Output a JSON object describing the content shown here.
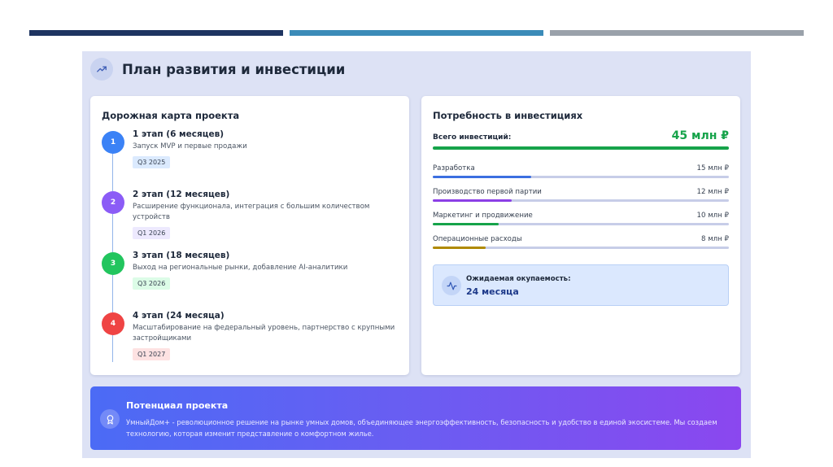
{
  "header": {
    "title": "План развития и инвестиции"
  },
  "roadmap": {
    "title": "Дорожная карта проекта",
    "stages": [
      {
        "num": "1",
        "name": "1 этап (6 месяцев)",
        "desc": "Запуск MVP и первые продажи",
        "badge": "Q3 2025",
        "color": "#3b82f6",
        "badge_bg": "#dbeafe"
      },
      {
        "num": "2",
        "name": "2 этап (12 месяцев)",
        "desc": "Расширение функционала, интеграция с большим количеством устройств",
        "badge": "Q1 2026",
        "color": "#8b5cf6",
        "badge_bg": "#ede9fe"
      },
      {
        "num": "3",
        "name": "3 этап (18 месяцев)",
        "desc": "Выход на региональные рынки, добавление AI-аналитики",
        "badge": "Q3 2026",
        "color": "#22c55e",
        "badge_bg": "#dcfce7"
      },
      {
        "num": "4",
        "name": "4 этап (24 месяца)",
        "desc": "Масштабирование на федеральный уровень, партнерство с крупными застройщиками",
        "badge": "Q1 2027",
        "color": "#ef4444",
        "badge_bg": "#fee2e2"
      }
    ]
  },
  "investment": {
    "title": "Потребность в инвестициях",
    "total_label": "Всего инвестиций:",
    "total_value": "45 млн ₽",
    "total_fill": 1.0,
    "items": [
      {
        "label": "Разработка",
        "value": "15 млн ₽",
        "fill": 0.333,
        "color": "#3b6fe0"
      },
      {
        "label": "Производство первой партии",
        "value": "12 млн ₽",
        "fill": 0.267,
        "color": "#8b3fe6"
      },
      {
        "label": "Маркетинг и продвижение",
        "value": "10 млн ₽",
        "fill": 0.222,
        "color": "#16a34a"
      },
      {
        "label": "Операционные расходы",
        "value": "8 млн ₽",
        "fill": 0.178,
        "color": "#b08a00"
      }
    ],
    "payback_label": "Ожидаемая окупаемость:",
    "payback_value": "24 месяца"
  },
  "potential": {
    "title": "Потенциал проекта",
    "text": "УмныйДом+ - революционное решение на рынке умных домов, объединяющее энергоэффективность, безопасность и удобство в единой экосистеме. Мы создаем технологию, которая изменит представление о комфортном жилье."
  },
  "icons": {
    "title": "trending-up-icon",
    "payback": "activity-icon",
    "potential": "award-icon"
  }
}
